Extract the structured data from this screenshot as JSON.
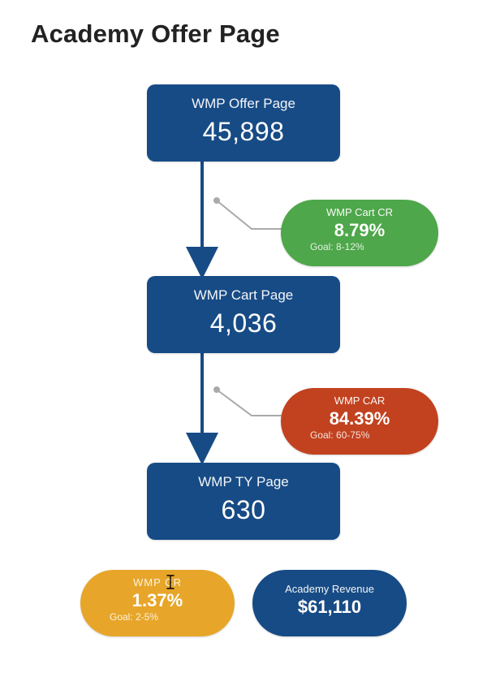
{
  "title": "Academy Offer Page",
  "colors": {
    "primary": "#174b85",
    "green": "#4ea74a",
    "red": "#c2421f",
    "orange": "#e7a62a"
  },
  "nodes": [
    {
      "label": "WMP Offer Page",
      "value": "45,898"
    },
    {
      "label": "WMP Cart Page",
      "value": "4,036"
    },
    {
      "label": "WMP TY Page",
      "value": "630"
    }
  ],
  "side_metrics": [
    {
      "label": "WMP Cart CR",
      "value": "8.79%",
      "goal": "Goal: 8-12%",
      "color": "green"
    },
    {
      "label": "WMP CAR",
      "value": "84.39%",
      "goal": "Goal: 60-75%",
      "color": "red"
    }
  ],
  "bottom_metrics": [
    {
      "label": "WMP CR",
      "value": "1.37%",
      "goal": "Goal: 2-5%",
      "color": "orange",
      "cursor": true
    },
    {
      "label": "Academy Revenue",
      "value": "$61,110",
      "goal": "",
      "color": "blue"
    }
  ]
}
